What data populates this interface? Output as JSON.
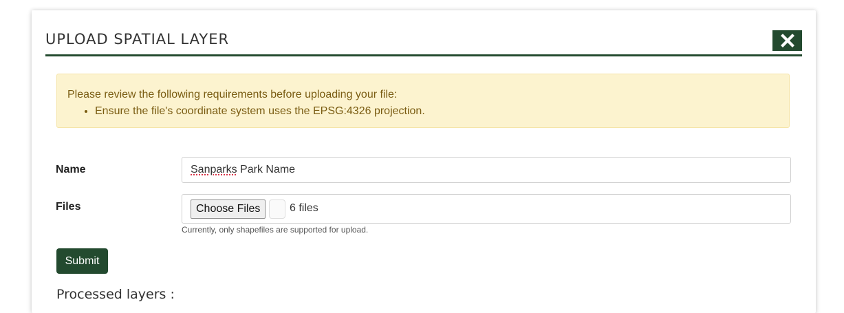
{
  "modal": {
    "title": "UPLOAD SPATIAL LAYER",
    "close_icon": "close-x-icon",
    "accent_color": "#234a2f"
  },
  "alert": {
    "intro": "Please review the following requirements before uploading your file:",
    "items": [
      "Ensure the file's coordinate system uses the EPSG:4326 projection."
    ],
    "background_color": "#fcf3cf",
    "text_color": "#7a5c12"
  },
  "form": {
    "name": {
      "label": "Name",
      "value_word1": "Sanparks",
      "value_rest": " Park Name"
    },
    "files": {
      "label": "Files",
      "button_label": "Choose Files",
      "selected_text": "6 files",
      "help": "Currently, only shapefiles are supported for upload."
    },
    "submit_label": "Submit"
  },
  "processed": {
    "heading": "Processed layers :"
  }
}
